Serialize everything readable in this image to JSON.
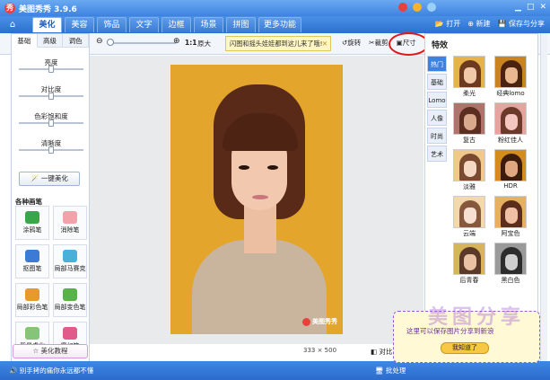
{
  "app": {
    "title": "美图秀秀 3.9.6",
    "logo_glyph": "秀"
  },
  "window_controls": [
    "▁",
    "□",
    "✕"
  ],
  "nav": {
    "tabs": [
      "美化",
      "美容",
      "饰品",
      "文字",
      "边框",
      "场景",
      "拼图",
      "更多功能"
    ],
    "active_tab": "美化",
    "open": "打开",
    "new": "新建",
    "save": "保存与分享"
  },
  "left_panel": {
    "subtabs": [
      "基础",
      "高级",
      "调色"
    ],
    "active_subtab": "基础",
    "sliders": [
      {
        "label": "亮度",
        "level": 0.5
      },
      {
        "label": "对比度",
        "level": 0.5
      },
      {
        "label": "色彩饱和度",
        "level": 0.5
      },
      {
        "label": "清晰度",
        "level": 0.5
      }
    ],
    "one_key": "一键美化",
    "pen_section": "各种画笔",
    "pens": [
      {
        "label": "涂鸦笔",
        "color": "#3aa64a"
      },
      {
        "label": "消除笔",
        "color": "#f0a3a8"
      },
      {
        "label": "抠图笔",
        "color": "#3b7bd6"
      },
      {
        "label": "局部马赛克",
        "color": "#49b1d8"
      },
      {
        "label": "局部彩色笔",
        "color": "#e69a2b"
      },
      {
        "label": "局部变色笔",
        "color": "#57b247"
      },
      {
        "label": "背景虚化",
        "color": "#86c47a"
      },
      {
        "label": "魔幻笔",
        "color": "#e05b8a"
      }
    ],
    "tutorial": "美化教程"
  },
  "canvas_toolbar": {
    "ratio": "1:1",
    "original": "原大",
    "notice": "闪图和摇头娃娃都到这儿来了哦!",
    "notice_close": "✕",
    "rotate": "旋转",
    "crop": "裁剪",
    "size": "尺寸"
  },
  "photo": {
    "watermark": "美图秀秀"
  },
  "canvas_status": {
    "dimensions": "333 × 500",
    "compare": "对比"
  },
  "right_panel": {
    "title": "特效",
    "categories": [
      "热门",
      "基础",
      "Lomo",
      "人像",
      "时尚",
      "艺术"
    ],
    "active_category": "热门",
    "effects": [
      {
        "label": "柔光",
        "hair": "#6b3a1f",
        "skin": "#f0c9a8",
        "bg": "#e8b24a"
      },
      {
        "label": "经典lomo",
        "hair": "#4a2210",
        "skin": "#e9b890",
        "bg": "#c98420"
      },
      {
        "label": "复古",
        "hair": "#5a2e20",
        "skin": "#d9a98e",
        "bg": "#b0726a"
      },
      {
        "label": "粉红佳人",
        "hair": "#6b3a2a",
        "skin": "#f4c6c0",
        "bg": "#e5a4a0"
      },
      {
        "label": "淡雅",
        "hair": "#7a4a30",
        "skin": "#f5d8c4",
        "bg": "#efc98a"
      },
      {
        "label": "HDR",
        "hair": "#3d1c0e",
        "skin": "#e0a880",
        "bg": "#d48c1c"
      },
      {
        "label": "云端",
        "hair": "#86593f",
        "skin": "#f7e0d2",
        "bg": "#f3d9a8"
      },
      {
        "label": "阿宝色",
        "hair": "#5a2e1a",
        "skin": "#efc0a6",
        "bg": "#e7b060"
      },
      {
        "label": "后青春",
        "hair": "#5b3a2a",
        "skin": "#e9c2a4",
        "bg": "#d7b45a"
      },
      {
        "label": "黑白色",
        "hair": "#2c2c2c",
        "skin": "#cfcfcf",
        "bg": "#9a9a9a"
      }
    ]
  },
  "status_bar": {
    "tip": "别手拷的痛你永远都不懂",
    "batch": "批处理"
  },
  "popup": {
    "text": "这里可以保存图片分享到新浪",
    "button": "我知道了"
  },
  "overlay_watermark": "美图分享"
}
